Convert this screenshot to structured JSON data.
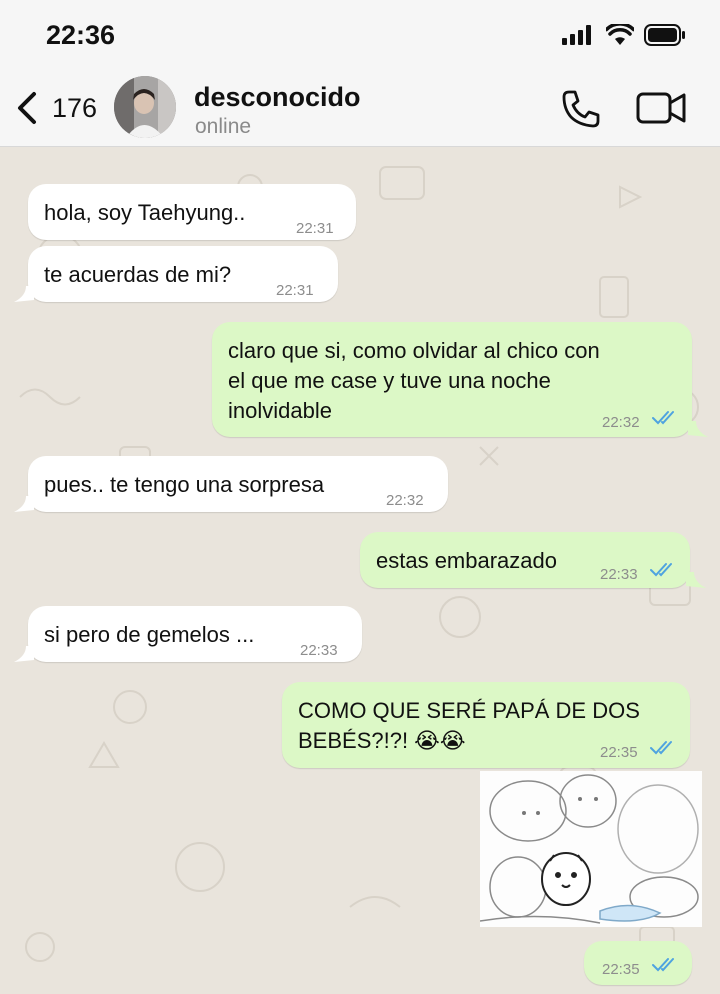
{
  "status_bar": {
    "time": "22:36"
  },
  "header": {
    "back_count": "176",
    "contact_name": "desconocido",
    "contact_status": "online"
  },
  "messages": [
    {
      "direction": "in",
      "text": "hola, soy Taehyung..",
      "time": "22:31"
    },
    {
      "direction": "in",
      "text": "te acuerdas de mi?",
      "time": "22:31"
    },
    {
      "direction": "out",
      "line1": "claro que si, como olvidar al chico con",
      "line2": "el que me case y tuve una noche",
      "line3": "inolvidable",
      "time": "22:32",
      "read": true
    },
    {
      "direction": "in",
      "text": "pues.. te tengo una sorpresa",
      "time": "22:32"
    },
    {
      "direction": "out",
      "text": "estas embarazado",
      "time": "22:33",
      "read": true
    },
    {
      "direction": "in",
      "text": "si pero de gemelos ...",
      "time": "22:33"
    },
    {
      "direction": "out",
      "line1": "COMO QUE SERÉ PAPÁ DE DOS",
      "line2": "BEBÉS?!?! 😭😭",
      "time": "22:35",
      "read": true
    },
    {
      "direction": "out",
      "type": "sticker",
      "time": "22:35",
      "read": true
    }
  ],
  "colors": {
    "incoming_bubble": "#ffffff",
    "outgoing_bubble": "#dcf8c6",
    "read_ticks": "#4fa3e0",
    "wallpaper": "#e9e4dc"
  }
}
